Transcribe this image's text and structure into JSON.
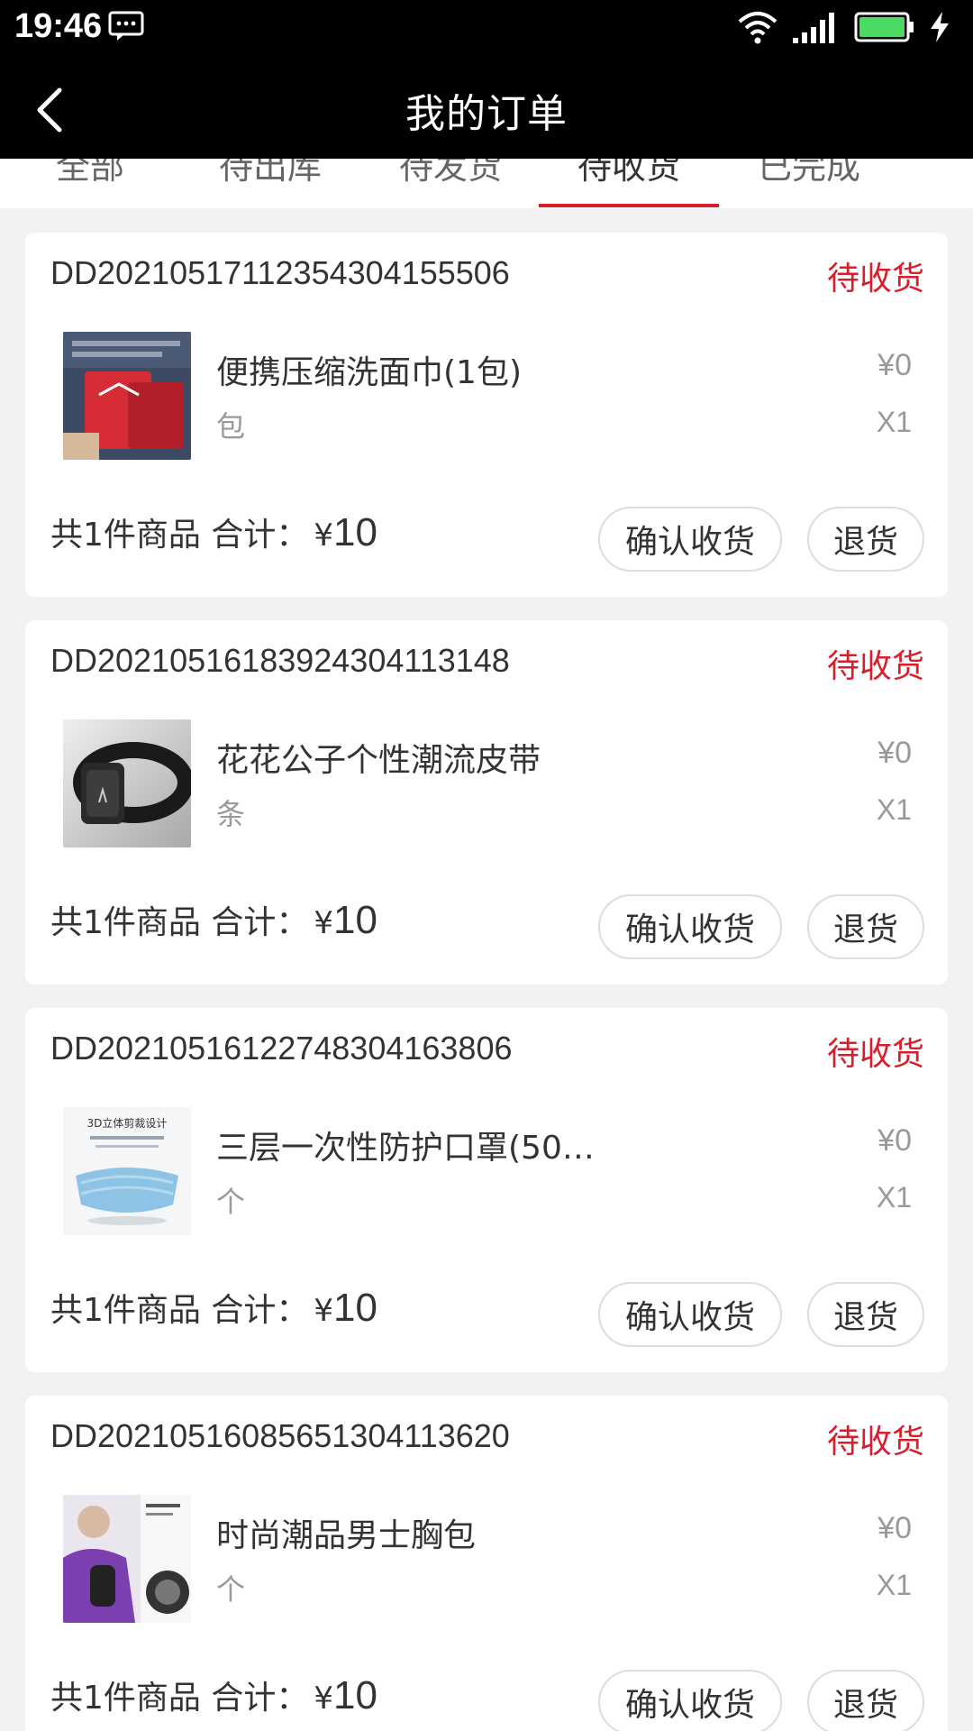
{
  "status_bar": {
    "time": "19:46"
  },
  "nav": {
    "title": "我的订单"
  },
  "tabs": [
    {
      "label": "全部"
    },
    {
      "label": "待出库"
    },
    {
      "label": "待发货"
    },
    {
      "label": "待收货",
      "active": true
    },
    {
      "label": "已完成"
    },
    {
      "label": "已"
    }
  ],
  "orders": [
    {
      "order_no": "DD20210517112354304155506",
      "status": "待收货",
      "product": {
        "name": "便携压缩洗面巾(1包)",
        "unit": "包",
        "price": "¥0",
        "qty": "X1",
        "image": "red-packet-towel"
      },
      "summary": {
        "count_label": "共1件商品 合计：",
        "currency": "¥",
        "total": "10"
      },
      "actions": {
        "confirm": "确认收货",
        "return": "退货"
      }
    },
    {
      "order_no": "DD20210516183924304113148",
      "status": "待收货",
      "product": {
        "name": "花花公子个性潮流皮带",
        "unit": "条",
        "price": "¥0",
        "qty": "X1",
        "image": "black-belt"
      },
      "summary": {
        "count_label": "共1件商品 合计：",
        "currency": "¥",
        "total": "10"
      },
      "actions": {
        "confirm": "确认收货",
        "return": "退货"
      }
    },
    {
      "order_no": "DD20210516122748304163806",
      "status": "待收货",
      "product": {
        "name": "三层一次性防护口罩(50…",
        "unit": "个",
        "price": "¥0",
        "qty": "X1",
        "image": "blue-mask",
        "image_text": "3D立体剪裁设计"
      },
      "summary": {
        "count_label": "共1件商品 合计：",
        "currency": "¥",
        "total": "10"
      },
      "actions": {
        "confirm": "确认收货",
        "return": "退货"
      }
    },
    {
      "order_no": "DD20210516085651304113620",
      "status": "待收货",
      "product": {
        "name": "时尚潮品男士胸包",
        "unit": "个",
        "price": "¥0",
        "qty": "X1",
        "image": "chest-bag"
      },
      "summary": {
        "count_label": "共1件商品 合计：",
        "currency": "¥",
        "total": "10"
      },
      "actions": {
        "confirm": "确认收货",
        "return": "退货"
      }
    }
  ],
  "colors": {
    "accent": "#d81e2a",
    "background": "#f2f2f4",
    "topbar": "#000000"
  }
}
